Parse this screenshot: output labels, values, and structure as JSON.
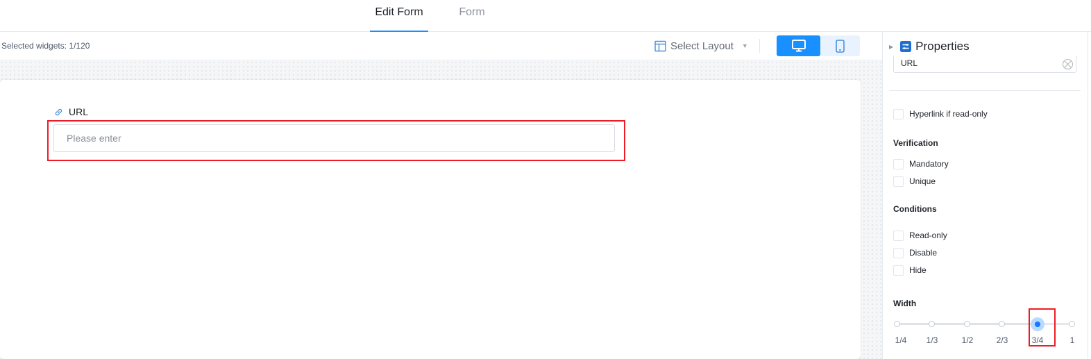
{
  "tabs": [
    {
      "label": "Edit Form",
      "active": true
    },
    {
      "label": "Form",
      "active": false
    }
  ],
  "toolbar": {
    "selected_widgets": "Selected widgets: 1/120",
    "select_layout": "Select Layout",
    "devices": [
      {
        "name": "desktop-icon",
        "active": true
      },
      {
        "name": "mobile-icon",
        "active": false
      }
    ]
  },
  "form": {
    "field_label": "URL",
    "field_icon": "link-icon",
    "placeholder": "Please enter",
    "value": ""
  },
  "properties": {
    "title": "Properties",
    "title_icon": "properties-icon",
    "name_value": "URL",
    "hyperlink_label": "Hyperlink if read-only",
    "verification_title": "Verification",
    "mandatory_label": "Mandatory",
    "unique_label": "Unique",
    "conditions_title": "Conditions",
    "readonly_label": "Read-only",
    "disable_label": "Disable",
    "hide_label": "Hide",
    "width_title": "Width",
    "width_options": [
      "1/4",
      "1/3",
      "1/2",
      "2/3",
      "3/4",
      "1"
    ],
    "width_selected": "3/4"
  },
  "colors": {
    "accent": "#1890ff",
    "highlight": "#ee1c25"
  }
}
